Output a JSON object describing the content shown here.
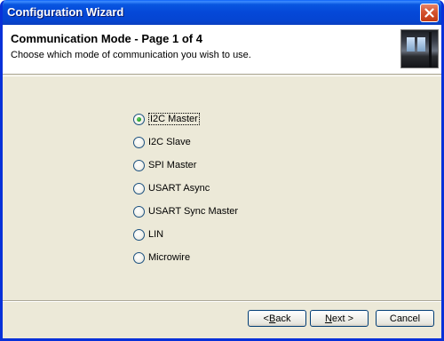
{
  "window": {
    "title": "Configuration Wizard",
    "close_icon": "close-icon"
  },
  "header": {
    "title": "Communication Mode  -  Page 1 of 4",
    "subtitle": "Choose which mode of communication you wish to use.",
    "image_icon": "wizard-banner-image"
  },
  "modes": {
    "selected_index": 0,
    "items": [
      {
        "label": "I2C Master"
      },
      {
        "label": "I2C Slave"
      },
      {
        "label": "SPI Master"
      },
      {
        "label": "USART Async"
      },
      {
        "label": "USART Sync Master"
      },
      {
        "label": "LIN"
      },
      {
        "label": "Microwire"
      }
    ]
  },
  "buttons": {
    "back_prefix": "< ",
    "back_mnemonic": "B",
    "back_rest": "ack",
    "next_mnemonic": "N",
    "next_rest": "ext >",
    "cancel": "Cancel"
  },
  "colors": {
    "title_bar": "#0548d8",
    "dialog_bg": "#ece9d8",
    "radio_selected": "#21a121"
  }
}
